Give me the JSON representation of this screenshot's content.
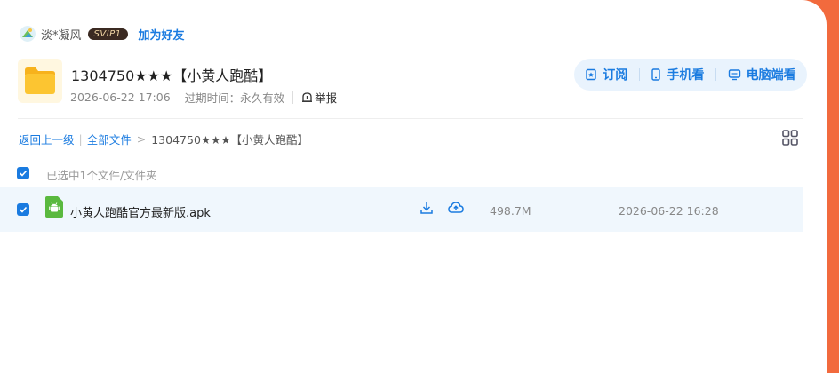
{
  "sharer": {
    "name": "淡*凝风",
    "vip_badge": "SVIP1",
    "add_friend_label": "加为好友"
  },
  "share": {
    "title": "1304750★★★【小黄人跑酷】",
    "created": "2026-06-22 17:06",
    "expire_label": "过期时间：永久有效",
    "report_label": "举报"
  },
  "actions": [
    {
      "label": "订阅",
      "icon": "subscribe-icon"
    },
    {
      "label": "手机看",
      "icon": "phone-icon"
    },
    {
      "label": "电脑端看",
      "icon": "monitor-icon"
    }
  ],
  "breadcrumb": {
    "back_label": "返回上一级",
    "all_files_label": "全部文件",
    "separator": ">",
    "current": "1304750★★★【小黄人跑酷】"
  },
  "selection": {
    "text": "已选中1个文件/文件夹",
    "all_checked": true
  },
  "files": [
    {
      "name": "小黄人跑酷官方最新版.apk",
      "size": "498.7M",
      "date": "2026-06-22 16:28",
      "checked": true,
      "icon": "android-apk-icon"
    }
  ],
  "colors": {
    "accent": "#1a7be0",
    "background": "#f26a3d",
    "row_highlight": "#f0f7fd",
    "action_bar": "#e9f3fd"
  }
}
